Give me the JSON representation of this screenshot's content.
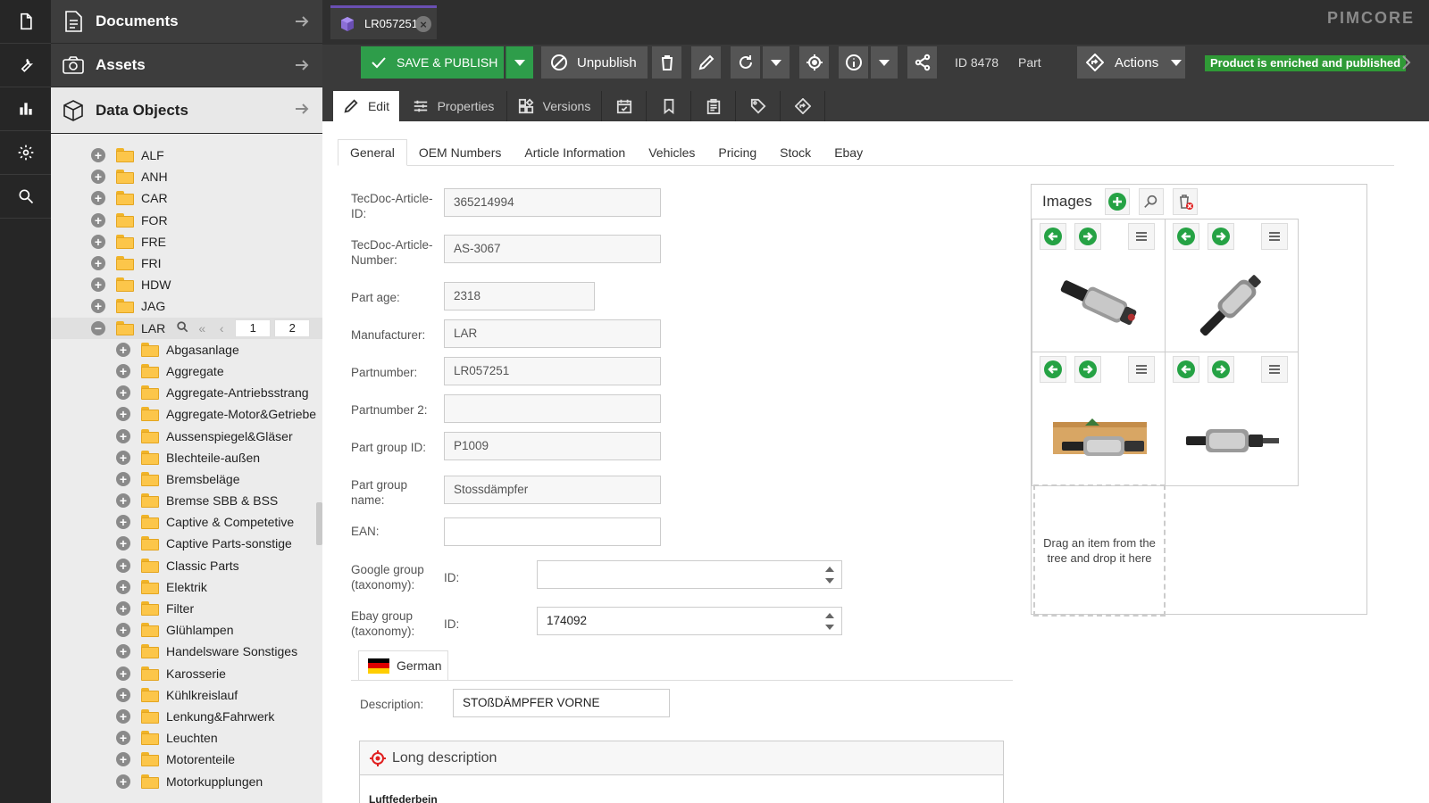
{
  "iconbar": [
    "file-icon",
    "wrench-icon",
    "bar-chart-icon",
    "gear-icon",
    "search-icon"
  ],
  "tree": {
    "documents_label": "Documents",
    "assets_label": "Assets",
    "data_objects_label": "Data Objects",
    "root_folders": [
      "ALF",
      "ANH",
      "CAR",
      "FOR",
      "FRE",
      "FRI",
      "HDW",
      "JAG"
    ],
    "selected_folder": "LAR",
    "pager": {
      "page1": "1",
      "page2": "2"
    },
    "child_folders": [
      "Abgasanlage",
      "Aggregate",
      "Aggregate-Antriebsstrang",
      "Aggregate-Motor&Getriebe",
      "Aussenspiegel&Gläser",
      "Blechteile-außen",
      "Bremsbeläge",
      "Bremse SBB & BSS",
      "Captive & Competetive",
      "Captive Parts-sonstige",
      "Classic Parts",
      "Elektrik",
      "Filter",
      "Glühlampen",
      "Handelsware Sonstiges",
      "Karosserie",
      "Kühlkreislauf",
      "Lenkung&Fahrwerk",
      "Leuchten",
      "Motorenteile",
      "Motorkupplungen"
    ]
  },
  "topbar": {
    "tab_title": "LR057251",
    "logo": "PIMCORE"
  },
  "toolbar": {
    "save_label": "Save & Publish",
    "unpublish_label": "Unpublish",
    "id_label": "ID 8478",
    "class_label": "Part",
    "actions_label": "Actions",
    "status_badge": "Product is enriched and published"
  },
  "subtabs": {
    "edit_label": "Edit",
    "properties_label": "Properties",
    "versions_label": "Versions"
  },
  "content_tabs": [
    "General",
    "OEM Numbers",
    "Article Information",
    "Vehicles",
    "Pricing",
    "Stock",
    "Ebay"
  ],
  "form": {
    "tecdoc_article_id_label": "TecDoc-Article-ID:",
    "tecdoc_article_id": "365214994",
    "tecdoc_article_number_label": "TecDoc-Article-Number:",
    "tecdoc_article_number": "AS-3067",
    "part_age_label": "Part age:",
    "part_age": "2318",
    "manufacturer_label": "Manufacturer:",
    "manufacturer": "LAR",
    "partnumber_label": "Partnumber:",
    "partnumber": "LR057251",
    "partnumber2_label": "Partnumber 2:",
    "partnumber2": "",
    "part_group_id_label": "Part group ID:",
    "part_group_id": "P1009",
    "part_group_name_label": "Part group name:",
    "part_group_name": "Stossdämpfer",
    "ean_label": "EAN:",
    "ean": "",
    "google_group_label": "Google group (taxonomy):",
    "google_group_id_label": "ID:",
    "google_group_id": "",
    "ebay_group_label": "Ebay group (taxonomy):",
    "ebay_group_id_label": "ID:",
    "ebay_group_id": "174092"
  },
  "images": {
    "title": "Images",
    "dropzone_text": "Drag an item from the tree and drop it here"
  },
  "localized": {
    "language": "German",
    "description_label": "Description:",
    "description": "STOßDÄMPFER VORNE",
    "long_description_title": "Long description",
    "long_description_text": "Luftfederbein"
  },
  "colors": {
    "accent_green": "#2e9d4a",
    "status_green": "#2f9a36",
    "tab_accent_purple": "#6a4fb3",
    "dark_bar": "#3a3a3a"
  }
}
